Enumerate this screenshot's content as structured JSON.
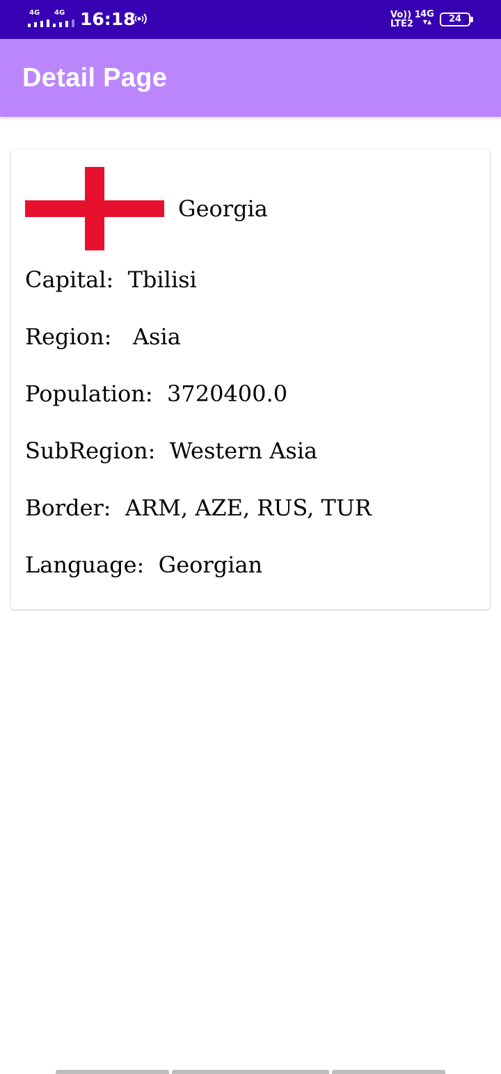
{
  "status_bar": {
    "network_left_1": "4G",
    "network_left_2": "4G",
    "time": "16:18",
    "volte_line1": "Vo)) 1",
    "volte_line2": "LTE2",
    "network_right": "4G",
    "battery_level": "24",
    "hotspot_icon": "hotspot-icon"
  },
  "app_bar": {
    "title": "Detail Page",
    "color": "#bb86fc",
    "status_color": "#3700b3"
  },
  "country": {
    "name": "Georgia",
    "flag_icon": "georgia-flag",
    "flag_color": "#e8112d",
    "rows": {
      "capital": "Capital:  Tbilisi",
      "region": "Region:   Asia",
      "population": "Population:  3720400.0",
      "subregion": "SubRegion:  Western Asia",
      "border": "Border:  ARM, AZE, RUS, TUR",
      "language": "Language:  Georgian"
    }
  }
}
